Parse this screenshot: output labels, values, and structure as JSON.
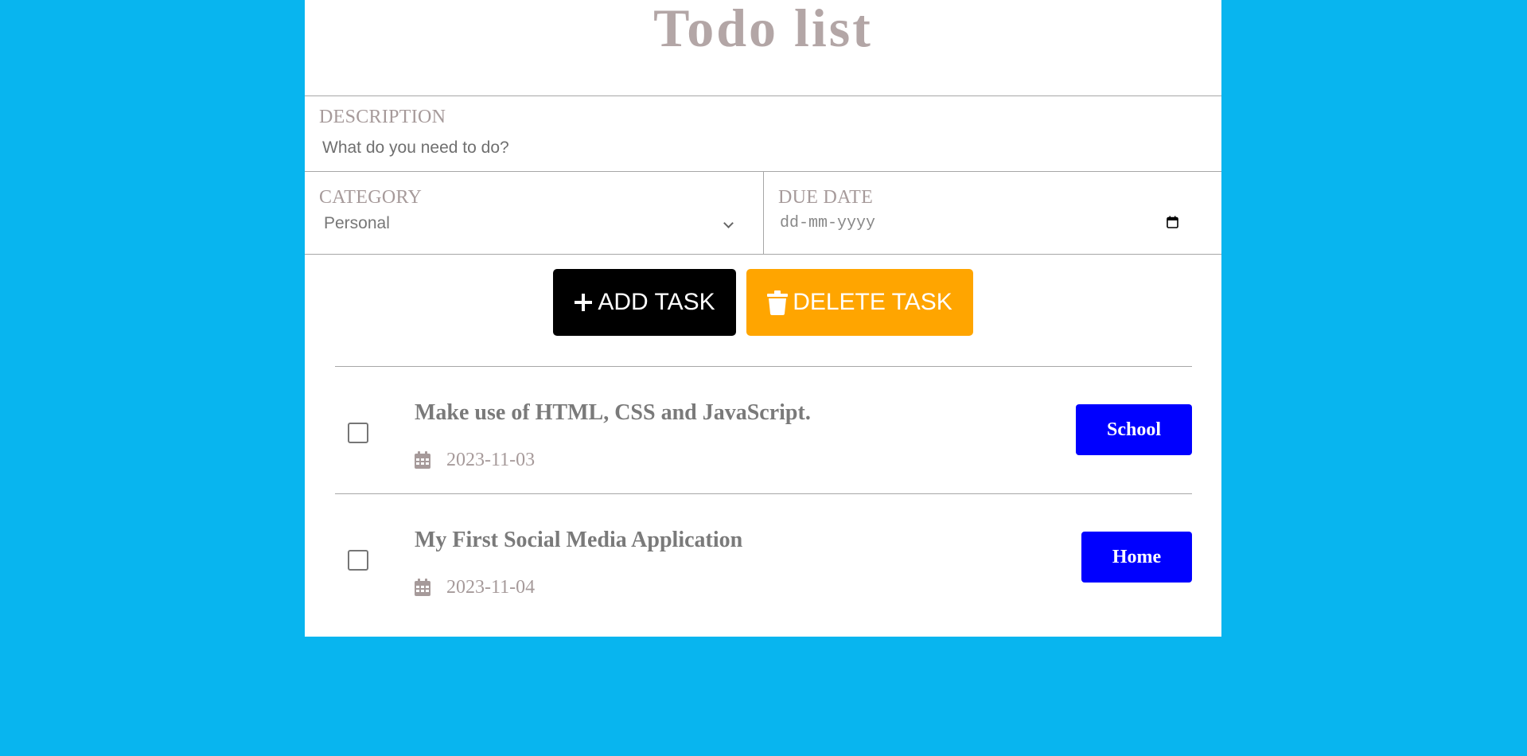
{
  "app": {
    "title": "Todo list"
  },
  "form": {
    "description_label": "DESCRIPTION",
    "description_placeholder": "What do you need to do?",
    "description_value": "",
    "category_label": "CATEGORY",
    "category_value": "Personal",
    "due_date_label": "DUE DATE",
    "due_date_placeholder": "dd-mm-yyyy"
  },
  "actions": {
    "add_label": "ADD TASK",
    "delete_label": "DELETE TASK"
  },
  "tasks": [
    {
      "title": "Make use of HTML, CSS and JavaScript.",
      "date": "2023-11-03",
      "category": "School",
      "checked": false
    },
    {
      "title": "My First Social Media Application",
      "date": "2023-11-04",
      "category": "Home",
      "checked": false
    }
  ],
  "colors": {
    "page_background": "#08b5ef",
    "card_background": "#ffffff",
    "title_text": "#b3a6a6",
    "add_button": "#000000",
    "delete_button": "#ffa500",
    "category_tag": "#0000ff"
  },
  "icons": {
    "add": "plus-icon",
    "delete": "trash-icon",
    "date_picker": "calendar-icon",
    "select": "chevron-down-icon",
    "task_date": "calendar-icon"
  }
}
